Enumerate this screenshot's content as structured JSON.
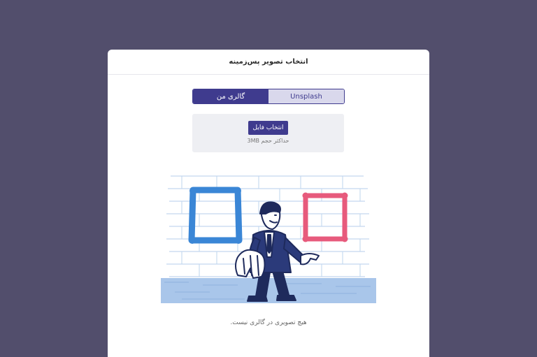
{
  "modal": {
    "title": "انتخاب تصویر پس‌زمینه",
    "tabs": [
      {
        "label": "گالری من",
        "active": true
      },
      {
        "label": "Unsplash",
        "active": false
      }
    ],
    "upload": {
      "button_label": "انتخاب فایل",
      "hint": "حداکثر حجم 3MB"
    },
    "empty_message": "هیچ تصویری در گالری نیست."
  },
  "colors": {
    "backdrop": "#524e6c",
    "accent": "#3f3b8e",
    "tab_inactive": "#d9d8ec",
    "frame_blue": "#3a86d6",
    "frame_pink": "#e75a7c"
  },
  "illustration": {
    "icon": "empty-gallery-illustration"
  }
}
